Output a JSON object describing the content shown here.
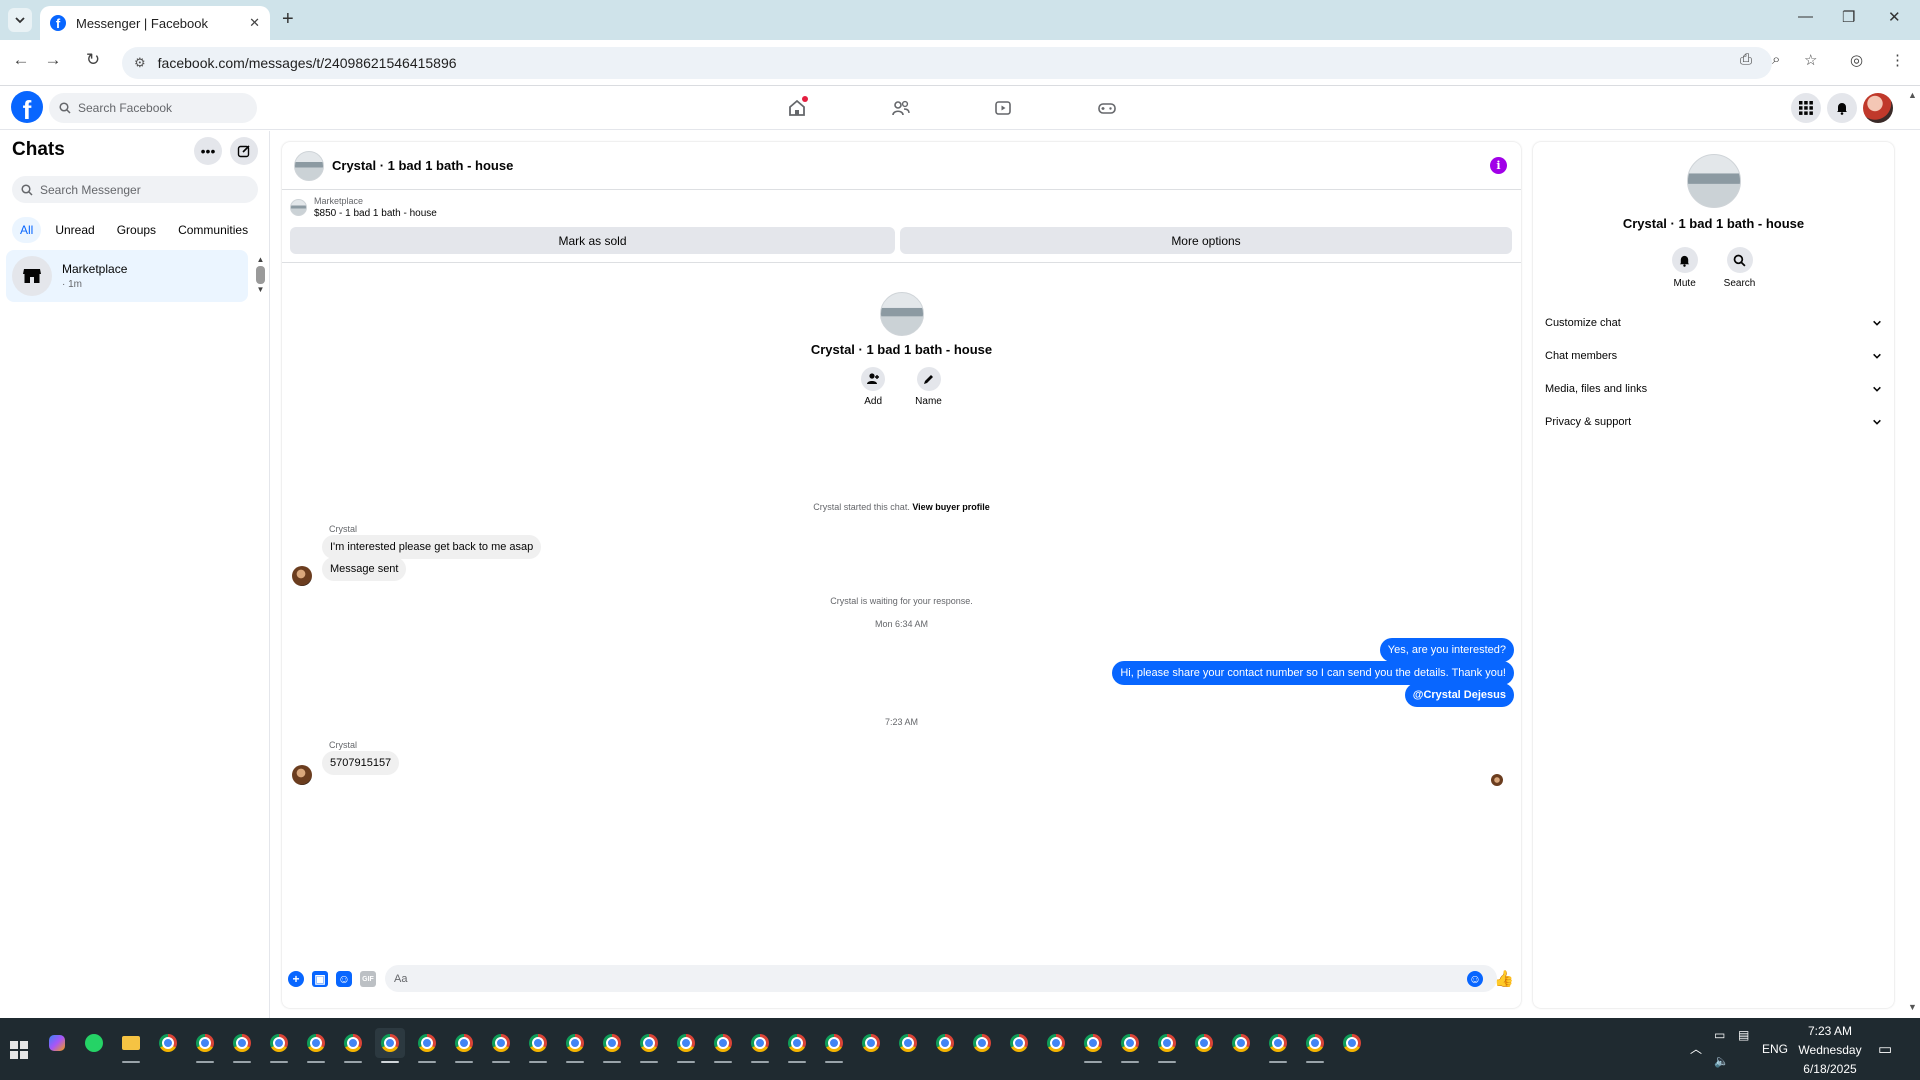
{
  "browser": {
    "tab_title": "Messenger | Facebook",
    "url": "facebook.com/messages/t/24098621546415896"
  },
  "fb": {
    "search_placeholder": "Search Facebook"
  },
  "chats": {
    "title": "Chats",
    "search_placeholder": "Search Messenger",
    "filters": [
      "All",
      "Unread",
      "Groups",
      "Communities"
    ],
    "items": [
      {
        "name": "Marketplace",
        "time": "· 1m"
      }
    ]
  },
  "conversation": {
    "title": "Crystal · 1 bad 1 bath - house",
    "marketplace_label": "Marketplace",
    "listing": "$850 - 1 bad 1 bath - house",
    "mark_sold": "Mark as sold",
    "more_options": "More options",
    "intro_name": "Crystal · 1 bad 1 bath - house",
    "add_label": "Add",
    "name_label": "Name",
    "started_text": "Crystal started this chat.",
    "view_profile": "View buyer profile",
    "sender1": "Crystal",
    "msg_in_1": "I'm interested please get back to me asap",
    "msg_in_2": "Message sent",
    "waiting": "Crystal is waiting for your response.",
    "time1": "Mon 6:34 AM",
    "msg_out_1": "Yes, are you interested?",
    "msg_out_2": "Hi, please share your contact number so I can send you the details. Thank you!",
    "msg_out_3": "@Crystal Dejesus",
    "time2": "7:23 AM",
    "sender2": "Crystal",
    "msg_in_3": "5707915157",
    "composer_placeholder": "Aa"
  },
  "details": {
    "name": "Crystal · 1 bad 1 bath - house",
    "mute": "Mute",
    "search": "Search",
    "sections": [
      "Customize chat",
      "Chat members",
      "Media, files and links",
      "Privacy & support"
    ]
  },
  "taskbar": {
    "lang": "ENG",
    "time": "7:23 AM",
    "day": "Wednesday",
    "date": "6/18/2025"
  },
  "colors": {
    "accent": "#0866ff",
    "info": "#a100e8"
  },
  "icons": [
    "chevron-down-icon",
    "facebook-icon",
    "close-icon",
    "plus-icon",
    "back-icon",
    "forward-icon",
    "reload-icon",
    "tune-icon",
    "install-icon",
    "zoom-icon",
    "star-icon",
    "profile-icon",
    "more-vert-icon",
    "facebook-logo",
    "search-icon",
    "home-icon",
    "friends-icon",
    "video-icon",
    "gaming-icon",
    "menu-grid-icon",
    "bell-icon",
    "more-icon",
    "compose-icon",
    "store-icon",
    "info-icon",
    "add-person-icon",
    "pencil-icon",
    "plus-circle-icon",
    "photo-icon",
    "sticker-icon",
    "gif-icon",
    "emoji-icon",
    "like-icon",
    "windows-icon",
    "chrome-icon"
  ]
}
